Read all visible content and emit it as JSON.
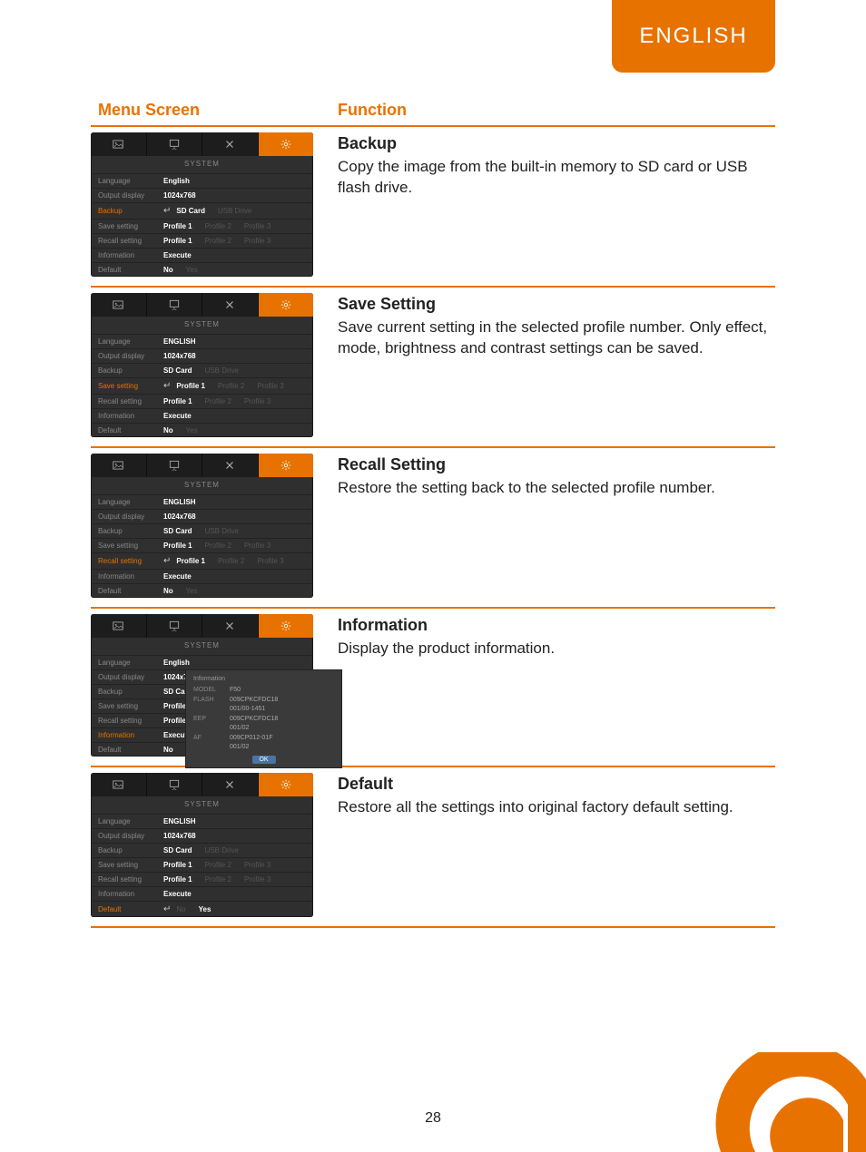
{
  "header": {
    "language_tab": "ENGLISH"
  },
  "table": {
    "col_menu": "Menu Screen",
    "col_func": "Function"
  },
  "functions": {
    "backup": {
      "title": "Backup",
      "desc": "Copy the image from the built-in memory to SD card or USB flash drive."
    },
    "save": {
      "title": "Save Setting",
      "desc": "Save current setting in the selected profile number. Only effect, mode, brightness and contrast settings can be saved."
    },
    "recall": {
      "title": "Recall Setting",
      "desc": "Restore the setting back to the selected profile number."
    },
    "info": {
      "title": "Information",
      "desc": "Display the product information."
    },
    "default": {
      "title": "Default",
      "desc": "Restore all the settings into original factory default setting."
    }
  },
  "osd": {
    "title": "SYSTEM",
    "labels": {
      "language": "Language",
      "output": "Output display",
      "backup": "Backup",
      "save": "Save setting",
      "recall": "Recall setting",
      "info": "Information",
      "default": "Default"
    },
    "values": {
      "language": "ENGLISH",
      "language_alt": "English",
      "output": "1024x768",
      "sd": "SD Card",
      "usb": "USB Drive",
      "p1": "Profile 1",
      "p2": "Profile 2",
      "p3": "Profile 3",
      "execute": "Execute",
      "no": "No",
      "yes": "Yes"
    }
  },
  "info_popup": {
    "title": "Information",
    "model_k": "MODEL",
    "model_v": "F50",
    "flash_k": "FLASH",
    "flash_v1": "009CPKCFDC18",
    "flash_v2": "001/00-1451",
    "eep_k": "EEP",
    "eep_v1": "009CPKCFDC18",
    "eep_v2": "001/02",
    "af_k": "AF",
    "af_v1": "009CP012-01F",
    "af_v2": "001/02",
    "ok": "OK"
  },
  "page_number": "28"
}
